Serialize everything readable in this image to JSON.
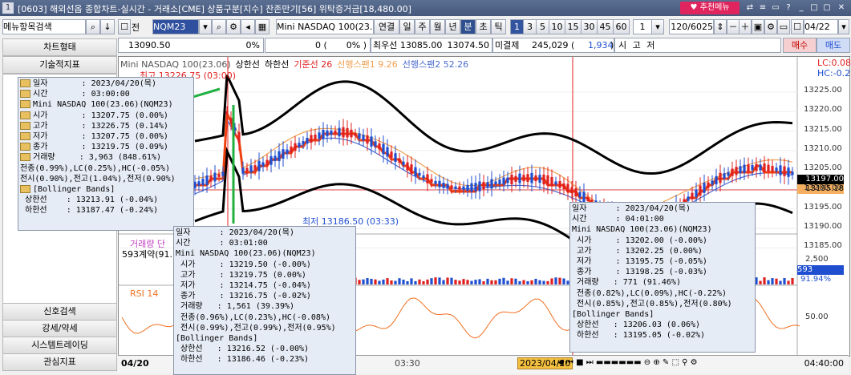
{
  "title": {
    "window": "[0603] 해외선옵 종합차트-실시간 - 거래소[CME] 상품구분[지수] 잔존만기[56] 위탁증거금[18,480.00]",
    "icon": "1",
    "recommend": "추천메뉴"
  },
  "toolbar1": {
    "menu_search": "메뉴항목검색",
    "code_label": "전",
    "code": "NQM23",
    "product": "Mini NASDAQ 100(23.0",
    "tabs": [
      "연결",
      "일",
      "주",
      "월",
      "년",
      "분",
      "초",
      "틱"
    ],
    "intervals": [
      "1",
      "3",
      "5",
      "10",
      "15",
      "30",
      "45",
      "60"
    ],
    "step": "1",
    "count": "120/6025",
    "date": "04/22"
  },
  "toolbar2": {
    "price": "13090.50",
    "pct": "0%",
    "zero": "0 (",
    "zero_pct": "0% )",
    "best_ask": "최우선 13085.00",
    "best_bid": "13074.50",
    "open_int_label": "미결제",
    "open_int": "245,029 (",
    "open_int_chg": "1,934",
    "open_int_close": ")",
    "market": "시 고 저",
    "buy": "매수",
    "sell": "매도"
  },
  "leftpanel": {
    "top": [
      "차트형태",
      "기술적지표"
    ],
    "bottom": [
      "신호검색",
      "강세/약세",
      "시스템트레이딩",
      "관심지표"
    ]
  },
  "chart": {
    "legend": [
      {
        "text": "Mini NASDAQ 100(23.06)",
        "color": "#555555"
      },
      {
        "text": "상한선",
        "color": "#000000"
      },
      {
        "text": "하한선",
        "color": "#000000"
      },
      {
        "text": "기준선 26",
        "color": "#e02020"
      },
      {
        "text": "선행스팬1 9.26",
        "color": "#f0a050"
      },
      {
        "text": "선행스팬2 52.26",
        "color": "#4a6ad0"
      }
    ],
    "high_label": "최고 13226.75 (03:00)",
    "low_label": "최저 13186.50 (03:33)",
    "lc": "LC:0.08",
    "hc": "HC:-0.22",
    "price_tag": "13197.00",
    "price_tag2": "13195.18",
    "y_ticks": [
      "13225.00",
      "13220.00",
      "13215.00",
      "13210.00",
      "13205.00",
      "13200.00",
      "13195.00",
      "13190.00",
      "13185.00"
    ]
  },
  "volume": {
    "label": "거래량",
    "label2": "단",
    "contracts": "593계약(91.",
    "y_tick": "2,500",
    "cur": "593",
    "pct": "91.94%"
  },
  "rsi": {
    "label": "RSI 14",
    "y_tick": "50.00"
  },
  "xaxis": {
    "date": "04/20",
    "t1": "03:30",
    "cursor": "2023/04/20",
    "right": "04:40:00"
  },
  "tip1": {
    "rows": [
      {
        "folder": true,
        "text": "일자       : 2023/04/20(목)"
      },
      {
        "folder": true,
        "text": "시간       : 03:00:00"
      },
      {
        "folder": true,
        "text": "Mini NASDAQ 100(23.06)(NQM23)"
      },
      {
        "folder": true,
        "text": "시가       : 13207.75 (0.00%)"
      },
      {
        "folder": true,
        "text": "고가       : 13226.75 (0.14%)"
      },
      {
        "folder": true,
        "text": "저가       : 13207.75 (0.00%)"
      },
      {
        "folder": true,
        "text": "종가       : 13219.75 (0.09%)"
      },
      {
        "folder": true,
        "text": "거래량     : 3,963 (848.61%)"
      },
      {
        "folder": false,
        "text": "전종(0.99%),LC(0.25%),HC(-0.05%)"
      },
      {
        "folder": false,
        "text": "전시(0.90%),전고(1.04%),전저(0.90%)"
      },
      {
        "folder": true,
        "text": "[Bollinger Bands]"
      },
      {
        "folder": false,
        "text": " 상한선    : 13213.91 (-0.04%)"
      },
      {
        "folder": false,
        "text": " 하한선    : 13187.47 (-0.24%)"
      }
    ]
  },
  "tip2": {
    "rows": [
      "일자      : 2023/04/20(목)",
      "시간      : 03:01:00",
      "Mini NASDAQ 100(23.06)(NQM23)",
      " 시가     : 13219.50 (-0.00%)",
      " 고가     : 13219.75 (0.00%)",
      " 저가     : 13214.75 (-0.04%)",
      " 종가     : 13216.75 (-0.02%)",
      " 거래량   : 1,561 (39.39%)",
      " 전종(0.96%),LC(0.23%),HC(-0.08%)",
      " 전시(0.99%),전고(0.99%),전저(0.95%)",
      "[Bollinger Bands]",
      " 상한선   : 13216.52 (-0.00%)",
      " 하한선   : 13186.46 (-0.23%)"
    ]
  },
  "tip3": {
    "rows": [
      "일자      : 2023/04/20(목)",
      "시간      : 04:01:00",
      "Mini NASDAQ 100(23.06)(NQM23)",
      " 시가     : 13202.00 (-0.00%)",
      " 고가     : 13202.25 (0.00%)",
      " 저가     : 13195.75 (-0.05%)",
      " 종가     : 13198.25 (-0.03%)",
      " 거래량   : 771 (91.46%)",
      " 전종(0.82%),LC(0.09%),HC(-0.22%)",
      " 전시(0.85%),전고(0.85%),전저(0.80%)",
      "[Bollinger Bands]",
      " 상한선   : 13206.03 (0.06%)",
      " 하한선   : 13195.05 (-0.02%)"
    ]
  },
  "colors": {
    "up": "#e02020",
    "down": "#1f4fd0",
    "kijun": "#f04010",
    "span1": "#f0a050",
    "span2": "#4a6ad0",
    "bb": "#000000",
    "highlight": "#20b040"
  }
}
